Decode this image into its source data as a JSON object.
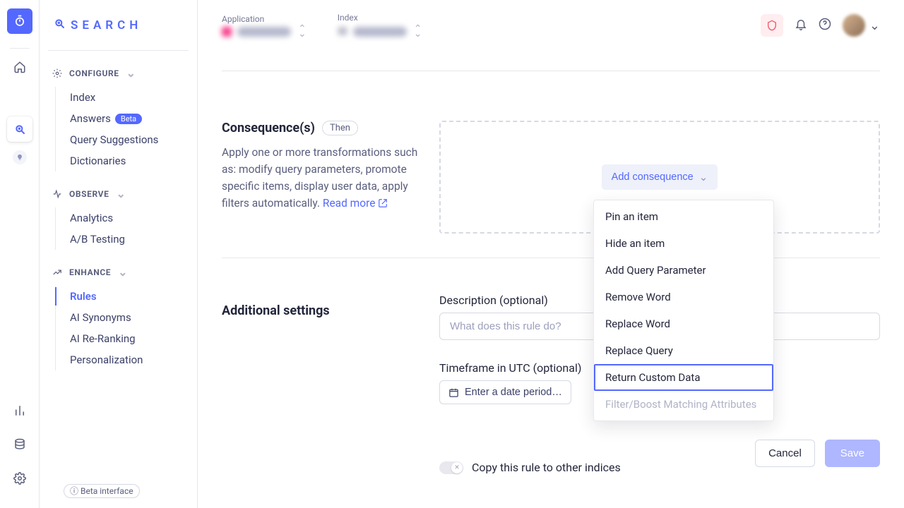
{
  "sidebar": {
    "title": "SEARCH",
    "sections": [
      {
        "head": "CONFIGURE",
        "items": [
          {
            "label": "Index"
          },
          {
            "label": "Answers",
            "beta": "Beta"
          },
          {
            "label": "Query Suggestions"
          },
          {
            "label": "Dictionaries"
          }
        ]
      },
      {
        "head": "OBSERVE",
        "items": [
          {
            "label": "Analytics"
          },
          {
            "label": "A/B Testing"
          }
        ]
      },
      {
        "head": "ENHANCE",
        "items": [
          {
            "label": "Rules",
            "active": true
          },
          {
            "label": "AI Synonyms"
          },
          {
            "label": "AI Re-Ranking"
          },
          {
            "label": "Personalization"
          }
        ]
      }
    ],
    "betaFooter": "Beta interface"
  },
  "header": {
    "applicationLabel": "Application",
    "indexLabel": "Index"
  },
  "consequence": {
    "title": "Consequence(s)",
    "pill": "Then",
    "description": "Apply one or more transformations such as: modify query parameters, promote specific items, display user data, apply filters automatically. ",
    "readMore": "Read more",
    "addLabel": "Add consequence",
    "menu": [
      "Pin an item",
      "Hide an item",
      "Add Query Parameter",
      "Remove Word",
      "Replace Word",
      "Replace Query",
      "Return Custom Data",
      "Filter/Boost Matching Attributes"
    ],
    "selectedIndex": 6,
    "disabledIndex": 7
  },
  "additional": {
    "title": "Additional settings",
    "descriptionLabel": "Description (optional)",
    "descriptionPlaceholder": "What does this rule do?",
    "timeframeLabel": "Timeframe in UTC (optional)",
    "timeframePlaceholder": "Enter a date period…",
    "copyLabel": "Copy this rule to other indices"
  },
  "footer": {
    "cancel": "Cancel",
    "save": "Save"
  }
}
